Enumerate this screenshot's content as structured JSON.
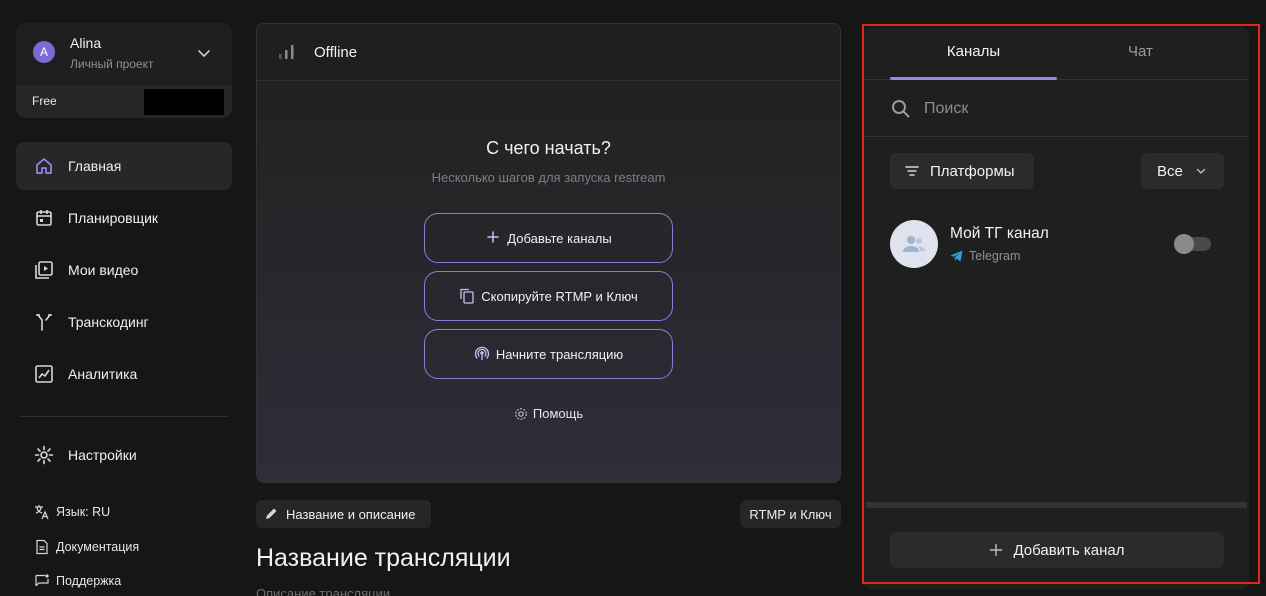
{
  "account": {
    "initial": "A",
    "name": "Alina",
    "project": "Личный проект",
    "plan": "Free"
  },
  "nav": {
    "items": [
      {
        "label": "Главная",
        "icon": "home-icon"
      },
      {
        "label": "Планировщик",
        "icon": "calendar-icon"
      },
      {
        "label": "Мои видео",
        "icon": "video-library-icon"
      },
      {
        "label": "Транскодинг",
        "icon": "fork-icon"
      },
      {
        "label": "Аналитика",
        "icon": "chart-icon"
      }
    ],
    "settings": "Настройки",
    "links": [
      {
        "label": "Язык: RU",
        "icon": "translate-icon"
      },
      {
        "label": "Документация",
        "icon": "document-icon"
      },
      {
        "label": "Поддержка",
        "icon": "chat-support-icon"
      }
    ]
  },
  "stream": {
    "status": "Offline",
    "start_title": "С чего начать?",
    "start_subtitle": "Несколько шагов для запуска restream",
    "steps": [
      {
        "label": "Добавьте каналы",
        "icon": "plus-icon"
      },
      {
        "label": "Скопируйте RTMP и Ключ",
        "icon": "copy-icon"
      },
      {
        "label": "Начните трансляцию",
        "icon": "broadcast-icon"
      }
    ],
    "help": "Помощь",
    "title_desc_button": "Название и описание",
    "rtmp_button": "RTMP и Ключ",
    "name": "Название трансляции",
    "description_placeholder": "Описание трансляции"
  },
  "right_panel": {
    "tabs": [
      "Каналы",
      "Чат"
    ],
    "active_tab": 0,
    "search_placeholder": "Поиск",
    "filter_label": "Платформы",
    "all_label": "Все",
    "channels": [
      {
        "name": "Мой ТГ канал",
        "platform": "Telegram",
        "enabled": false
      }
    ],
    "add_channel": "Добавить канал"
  },
  "colors": {
    "accent": "#9a86ea",
    "highlight_frame": "#e0271c",
    "telegram": "#2aa3e0"
  }
}
